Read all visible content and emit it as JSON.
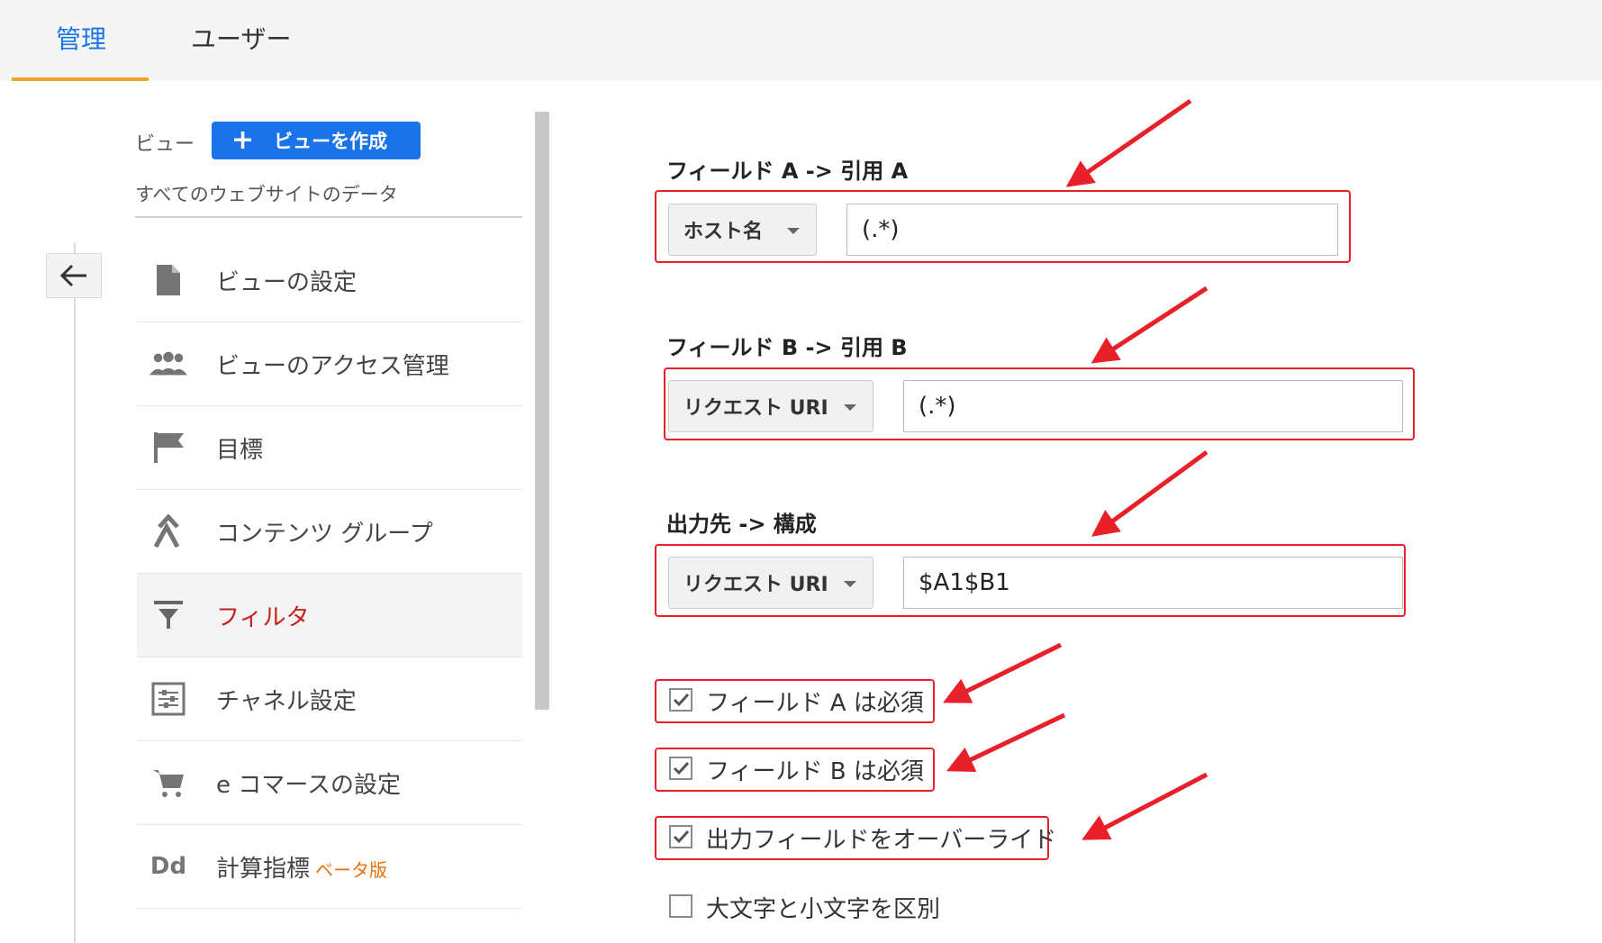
{
  "tabs": [
    {
      "label": "管理",
      "active": true
    },
    {
      "label": "ユーザー",
      "active": false
    }
  ],
  "sidebar": {
    "view_label": "ビュー",
    "create_view_button": "ビューを作成",
    "view_name": "すべてのウェブサイトのデータ",
    "items": [
      {
        "label": "ビューの設定",
        "icon": "document-icon"
      },
      {
        "label": "ビューのアクセス管理",
        "icon": "people-icon"
      },
      {
        "label": "目標",
        "icon": "flag-icon"
      },
      {
        "label": "コンテンツ グループ",
        "icon": "content-group-icon"
      },
      {
        "label": "フィルタ",
        "icon": "filter-icon",
        "active": true
      },
      {
        "label": "チャネル設定",
        "icon": "channel-settings-icon"
      },
      {
        "label": "e コマースの設定",
        "icon": "cart-icon"
      },
      {
        "label": "計算指標",
        "icon": "dd-icon",
        "badge": "ベータ版"
      }
    ]
  },
  "form": {
    "field_a": {
      "title": "フィールド A -> 引用 A",
      "dropdown": "ホスト名",
      "value": "(.*)"
    },
    "field_b": {
      "title": "フィールド B -> 引用 B",
      "dropdown": "リクエスト URI",
      "value": "(.*)"
    },
    "output": {
      "title": "出力先 -> 構成",
      "dropdown": "リクエスト URI",
      "value": "$A1$B1"
    },
    "checkboxes": [
      {
        "label": "フィールド A は必須",
        "checked": true
      },
      {
        "label": "フィールド B は必須",
        "checked": true
      },
      {
        "label": "出力フィールドをオーバーライド",
        "checked": true
      },
      {
        "label": "大文字と小文字を区別",
        "checked": false
      }
    ]
  },
  "colors": {
    "accent": "#1a73e8",
    "tab_underline": "#f4a32a",
    "highlight": "#e8202a",
    "active_nav": "#c5221f"
  }
}
